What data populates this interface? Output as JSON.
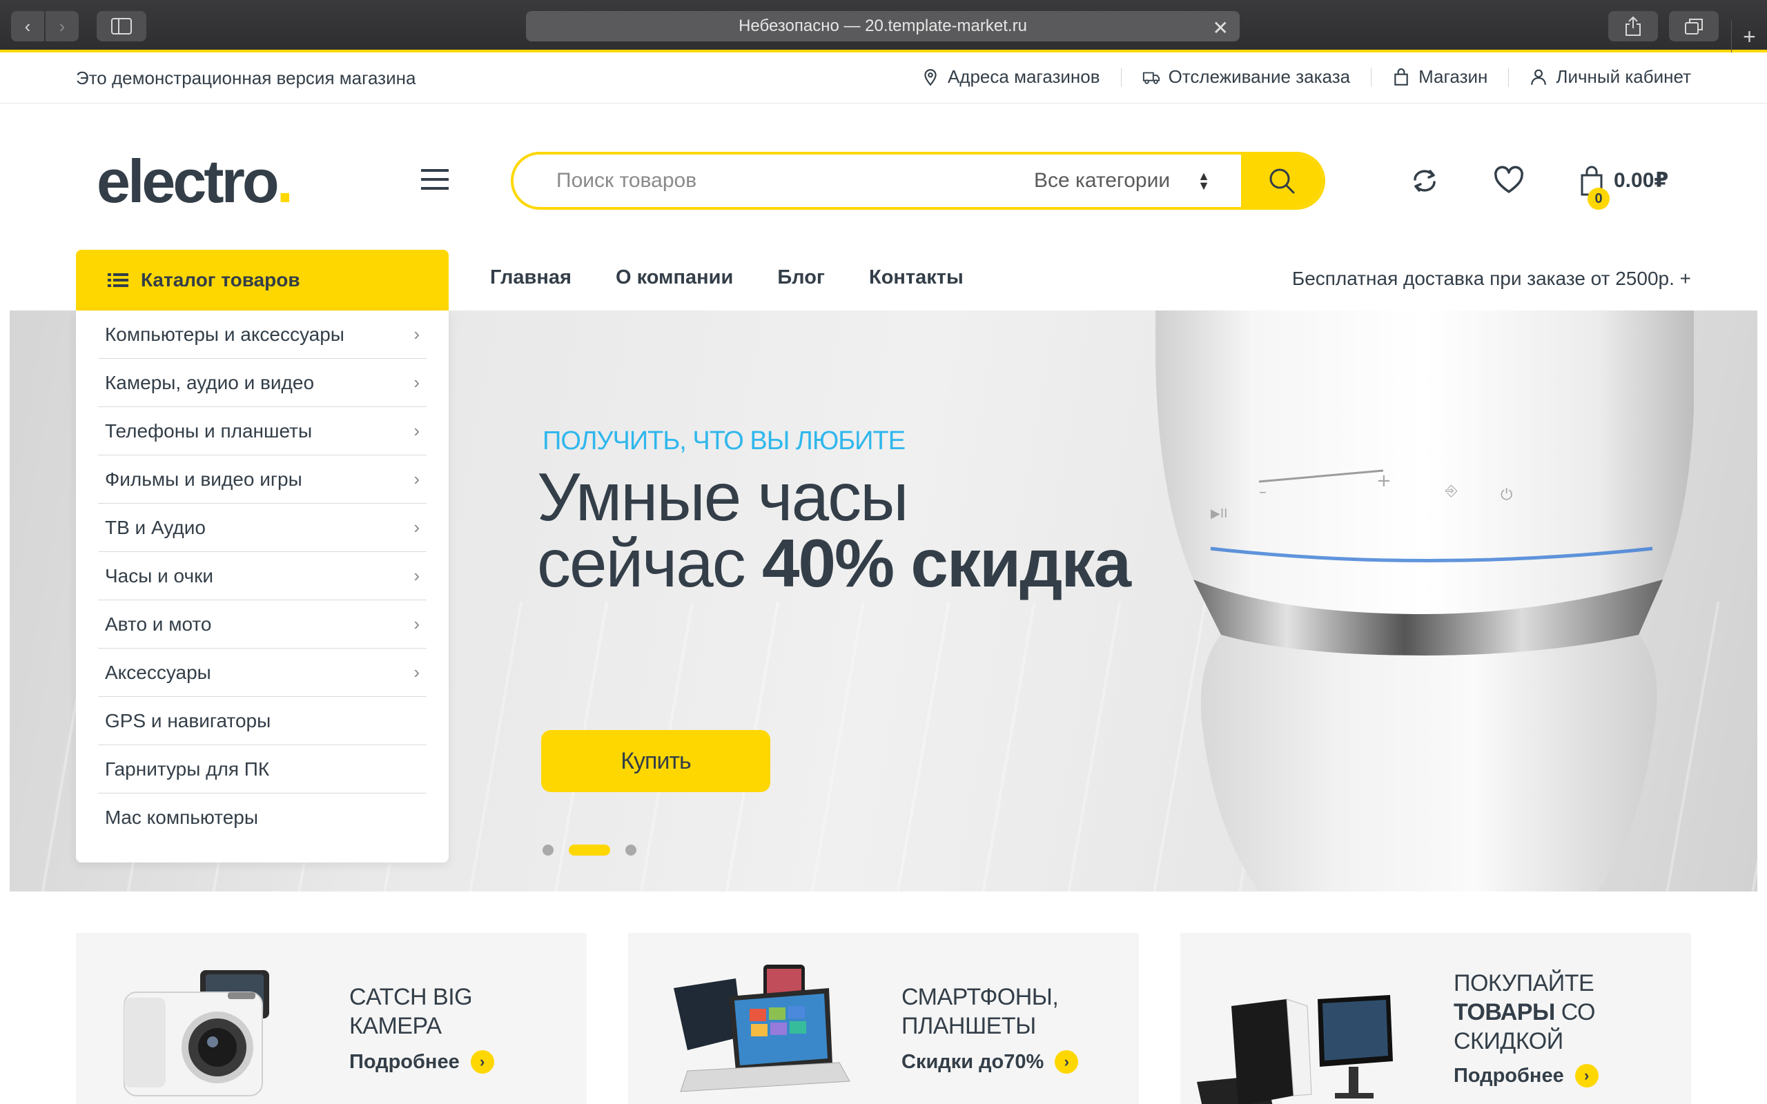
{
  "browser": {
    "url_text": "Небезопасно — 20.template-market.ru"
  },
  "topbar": {
    "demo_text": "Это демонстрационная версия магазина",
    "links": [
      {
        "label": "Адреса магазинов",
        "icon": "map-pin-icon"
      },
      {
        "label": "Отслеживание заказа",
        "icon": "truck-icon"
      },
      {
        "label": "Магазин",
        "icon": "shopping-bag-icon"
      },
      {
        "label": "Личный кабинет",
        "icon": "user-icon"
      }
    ]
  },
  "header": {
    "logo": "electro",
    "search_placeholder": "Поиск товаров",
    "category_select": "Все категории",
    "cart_total": "0.00₽",
    "cart_count": "0"
  },
  "nav": {
    "catalog_label": "Каталог товаров",
    "items": [
      "Главная",
      "О компании",
      "Блог",
      "Контакты"
    ],
    "delivery": "Бесплатная доставка при заказе от 2500р. +"
  },
  "catalog": [
    {
      "label": "Компьютеры и аксессуары",
      "has_sub": true
    },
    {
      "label": "Камеры, аудио и видео",
      "has_sub": true
    },
    {
      "label": "Телефоны и планшеты",
      "has_sub": true
    },
    {
      "label": "Фильмы и видео игры",
      "has_sub": true
    },
    {
      "label": "ТВ и Аудио",
      "has_sub": true
    },
    {
      "label": "Часы и очки",
      "has_sub": true
    },
    {
      "label": "Авто и мото",
      "has_sub": true
    },
    {
      "label": "Аксессуары",
      "has_sub": true
    },
    {
      "label": "GPS и навигаторы",
      "has_sub": false
    },
    {
      "label": "Гарнитуры для ПК",
      "has_sub": false
    },
    {
      "label": "Mac компьютеры",
      "has_sub": false
    }
  ],
  "hero": {
    "eyebrow": "ПОЛУЧИТЬ, ЧТО ВЫ ЛЮБИТЕ",
    "title_line1": "Умные часы",
    "title_line2_light": "сейчас ",
    "title_line2_bold": "40% скидка",
    "button": "Купить",
    "slides": 3,
    "active_slide": 2
  },
  "promos": [
    {
      "line1": "CATCH BIG",
      "line2": "КАМЕРА",
      "link": "Подробнее"
    },
    {
      "line1": "СМАРТФОНЫ,",
      "line2": "ПЛАНШЕТЫ",
      "link": "Скидки до70%"
    },
    {
      "line1": "ПОКУПАЙТЕ",
      "line2_bold": "ТОВАРЫ",
      "line2_rest": " СО",
      "line3": "СКИДКОЙ",
      "link": "Подробнее"
    }
  ],
  "colors": {
    "accent": "#fed700",
    "text": "#333e48",
    "eyebrow": "#2fb7ec"
  }
}
